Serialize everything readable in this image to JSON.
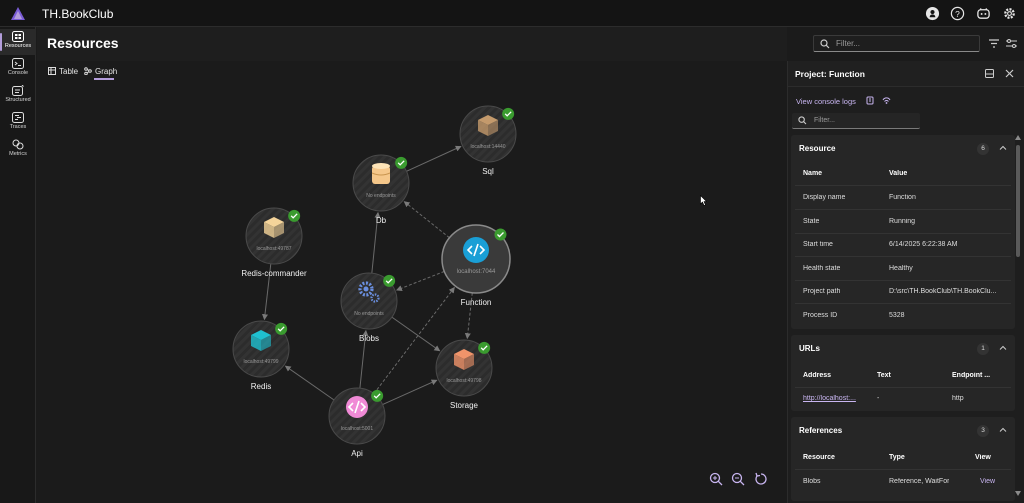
{
  "app": {
    "title": "TH.BookClub",
    "brand_color": "#7a5cd6"
  },
  "top_icons": [
    "github-icon",
    "help-icon",
    "copilot-icon",
    "settings-icon"
  ],
  "nav": {
    "items": [
      {
        "id": "resources",
        "label": "Resources",
        "icon": "resources-icon",
        "active": true
      },
      {
        "id": "console",
        "label": "Console",
        "icon": "console-icon",
        "active": false
      },
      {
        "id": "structured",
        "label": "Structured",
        "icon": "structured-icon",
        "active": false
      },
      {
        "id": "traces",
        "label": "Traces",
        "icon": "traces-icon",
        "active": false
      },
      {
        "id": "metrics",
        "label": "Metrics",
        "icon": "metrics-icon",
        "active": false
      }
    ]
  },
  "page": {
    "title": "Resources",
    "filter_placeholder": "Filter...",
    "tabs": [
      {
        "label": "Table",
        "icon": "table-icon",
        "active": false
      },
      {
        "label": "Graph",
        "icon": "graph-icon",
        "active": true
      }
    ]
  },
  "graph": {
    "nodes": [
      {
        "id": "sql",
        "name": "Sql",
        "endpoint": "localhost:14440",
        "icon": "box-icon",
        "icon_color": "#c49a6c",
        "status": "healthy"
      },
      {
        "id": "db",
        "name": "Db",
        "endpoint": "No endpoints",
        "icon": "database-icon",
        "icon_color": "#f5c78a",
        "status": "healthy"
      },
      {
        "id": "function",
        "name": "Function",
        "endpoint": "localhost:7044",
        "icon": "code-icon",
        "icon_color": "#1a9fd6",
        "status": "healthy",
        "selected": true
      },
      {
        "id": "redis-commander",
        "name": "Redis-commander",
        "endpoint": "localhost:49787",
        "icon": "box-icon",
        "icon_color": "#f5d49a",
        "status": "healthy"
      },
      {
        "id": "blobs",
        "name": "Blobs",
        "endpoint": "No endpoints",
        "icon": "gears-icon",
        "icon_color": "#6a8fe0",
        "status": "healthy"
      },
      {
        "id": "redis",
        "name": "Redis",
        "endpoint": "localhost:49799",
        "icon": "box-icon",
        "icon_color": "#1fc0d0",
        "status": "healthy"
      },
      {
        "id": "storage",
        "name": "Storage",
        "endpoint": "localhost:49798",
        "icon": "box-icon",
        "icon_color": "#f0946a",
        "status": "healthy"
      },
      {
        "id": "api",
        "name": "Api",
        "endpoint": "localhost:5001",
        "icon": "code-icon",
        "icon_color": "#f08ad6",
        "status": "healthy"
      }
    ],
    "edges": [
      {
        "from": "db",
        "to": "sql",
        "dashed": false
      },
      {
        "from": "function",
        "to": "db",
        "dashed": true
      },
      {
        "from": "function",
        "to": "blobs",
        "dashed": true
      },
      {
        "from": "function",
        "to": "storage",
        "dashed": true
      },
      {
        "from": "blobs",
        "to": "db",
        "dashed": false
      },
      {
        "from": "blobs",
        "to": "storage",
        "dashed": false
      },
      {
        "from": "redis-commander",
        "to": "redis",
        "dashed": false
      },
      {
        "from": "api",
        "to": "redis",
        "dashed": false
      },
      {
        "from": "api",
        "to": "blobs",
        "dashed": false
      },
      {
        "from": "api",
        "to": "function",
        "dashed": true
      },
      {
        "from": "api",
        "to": "storage",
        "dashed": false
      }
    ],
    "zoom_controls": [
      "zoom-in-icon",
      "zoom-out-icon",
      "reset-icon"
    ]
  },
  "panel": {
    "title": "Project: Function",
    "view_console_logs": "View console logs",
    "filter_placeholder": "Filter...",
    "resource": {
      "title": "Resource",
      "count": "6",
      "headers": [
        "Name",
        "Value"
      ],
      "rows": [
        [
          "Display name",
          "Function"
        ],
        [
          "State",
          "Running"
        ],
        [
          "Start time",
          "6/14/2025 6:22:38 AM"
        ],
        [
          "Health state",
          "Healthy"
        ],
        [
          "Project path",
          "D:\\src\\TH.BookClub\\TH.BookClu..."
        ],
        [
          "Process ID",
          "5328"
        ]
      ]
    },
    "urls": {
      "title": "URLs",
      "count": "1",
      "headers": [
        "Address",
        "Text",
        "Endpoint ..."
      ],
      "rows": [
        [
          "http://localhost:...",
          "-",
          "http"
        ]
      ]
    },
    "references": {
      "title": "References",
      "count": "3",
      "headers": [
        "Resource",
        "Type",
        "View"
      ],
      "rows": [
        [
          "Blobs",
          "Reference, WaitFor",
          "View"
        ]
      ]
    }
  }
}
